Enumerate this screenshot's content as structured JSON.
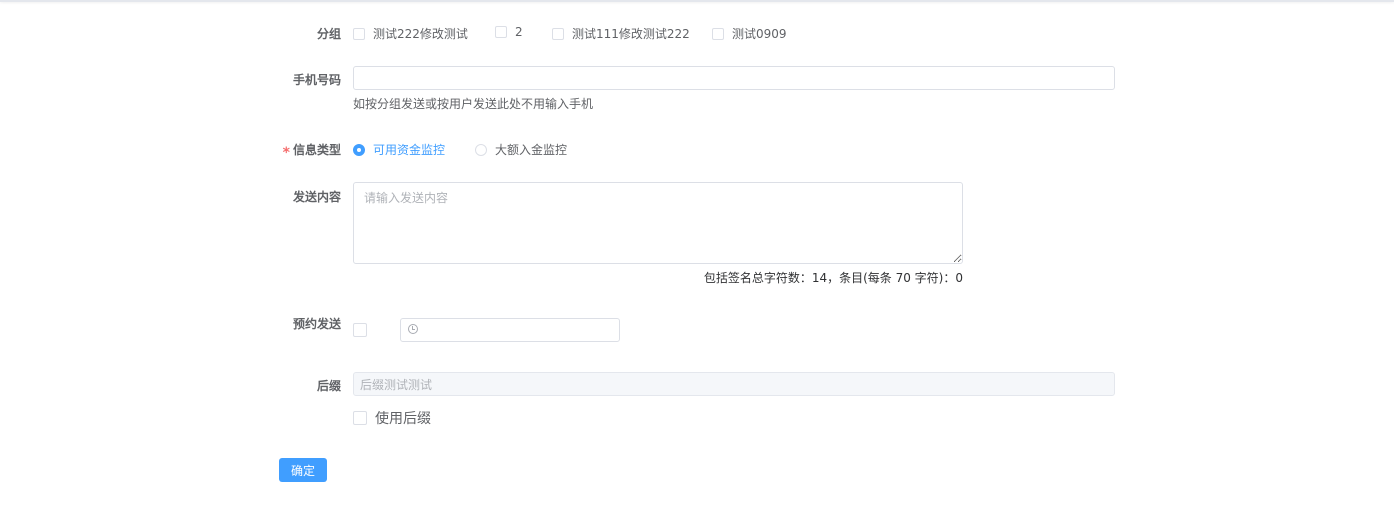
{
  "form": {
    "group": {
      "label": "分组",
      "options": [
        "测试222修改测试",
        "2",
        "测试111修改测试222",
        "测试0909"
      ]
    },
    "phone": {
      "label": "手机号码",
      "value": "",
      "hint": "如按分组发送或按用户发送此处不用输入手机"
    },
    "message_type": {
      "required_mark": "*",
      "label": "信息类型",
      "options": [
        "可用资金监控",
        "大额入金监控"
      ],
      "selected": "可用资金监控"
    },
    "content": {
      "label": "发送内容",
      "placeholder": "请输入发送内容",
      "counter": "包括签名总字符数：14，条目(每条 70 字符)：0"
    },
    "schedule": {
      "label": "预约发送",
      "time_value": ""
    },
    "suffix": {
      "label": "后缀",
      "value": "后缀测试测试",
      "use_label": "使用后缀"
    },
    "submit_label": "确定"
  },
  "colors": {
    "primary": "#409eff",
    "required": "#f56c6c",
    "border": "#dcdfe6"
  }
}
